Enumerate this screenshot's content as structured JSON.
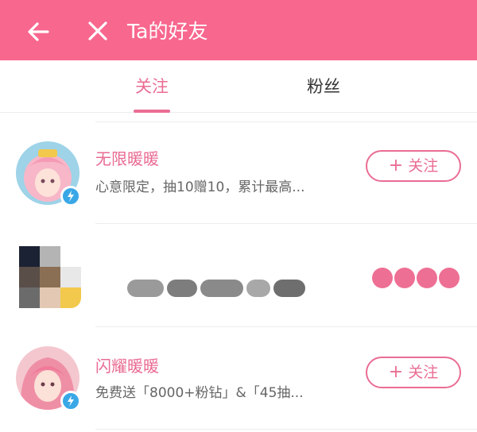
{
  "header": {
    "title": "Ta的好友",
    "bg_color": "#f8678e",
    "back_icon": "back-arrow-icon",
    "close_icon": "close-icon"
  },
  "tabs": [
    {
      "label": "关注",
      "active": true
    },
    {
      "label": "粉丝",
      "active": false
    }
  ],
  "accent_color": "#ea6d93",
  "list": [
    {
      "name": "无限暖暖",
      "description": "心意限定，抽10赠10，累计最高...",
      "verified_icon": "lightning-badge-icon",
      "button_label": "关注",
      "button_icon": "plus-icon"
    },
    {
      "name": "",
      "description": "",
      "obscured": true
    },
    {
      "name": "闪耀暖暖",
      "description": "免费送「8000+粉钻」&「45抽...",
      "verified_icon": "lightning-badge-icon",
      "button_label": "关注",
      "button_icon": "plus-icon"
    }
  ]
}
